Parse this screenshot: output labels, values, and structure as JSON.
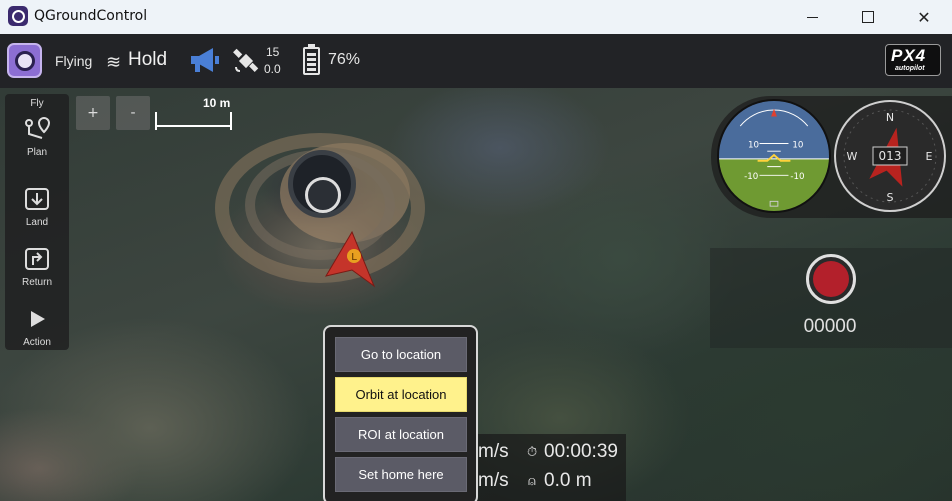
{
  "window": {
    "title": "QGroundControl",
    "controls": {
      "minimize": "",
      "maximize": "",
      "close": "✕"
    }
  },
  "toolbar": {
    "flight_status": "Flying",
    "flight_mode": "Hold",
    "mode_icon": "≋",
    "satellite_count": "15",
    "hdop": "0.0",
    "battery_percent": "76%",
    "brand_logo_text": "PX4",
    "brand_logo_subtext": "autopilot",
    "icons": [
      "qgc-logo-icon",
      "megaphone-icon",
      "satellite-icon",
      "battery-icon",
      "px4-logo"
    ]
  },
  "fly_toolstrip": {
    "title": "Fly",
    "items": [
      {
        "label": "Plan",
        "icon": "plan-icon"
      },
      {
        "label": "Land",
        "icon": "land-icon"
      },
      {
        "label": "Return",
        "icon": "return-icon"
      },
      {
        "label": "Action",
        "icon": "action-icon"
      }
    ]
  },
  "map_controls": {
    "zoom_in": "+",
    "zoom_out": "-",
    "scale_label": "10 m"
  },
  "vehicle": {
    "marker_label": "L"
  },
  "instruments": {
    "attitude_pitch_labels": [
      "10",
      "10",
      "-10",
      "-10"
    ],
    "compass_heading": "013",
    "compass_labels": [
      "N",
      "E",
      "S",
      "W"
    ],
    "colors": {
      "sky": "#4a6c9c",
      "ground": "#6f9a32",
      "heading_arrow": "#b8231f"
    }
  },
  "video": {
    "record_count": "00000",
    "record_color": "#b3202b"
  },
  "telemetry": {
    "speed_1": "m/s",
    "speed_2": "m/s",
    "flight_time": "00:00:39",
    "altitude": "0.0 m"
  },
  "context_menu": {
    "items": [
      {
        "label": "Go to location",
        "highlighted": false
      },
      {
        "label": "Orbit at location",
        "highlighted": true
      },
      {
        "label": "ROI at location",
        "highlighted": false
      },
      {
        "label": "Set home here",
        "highlighted": false
      }
    ],
    "highlight_color": "#fff28c"
  }
}
